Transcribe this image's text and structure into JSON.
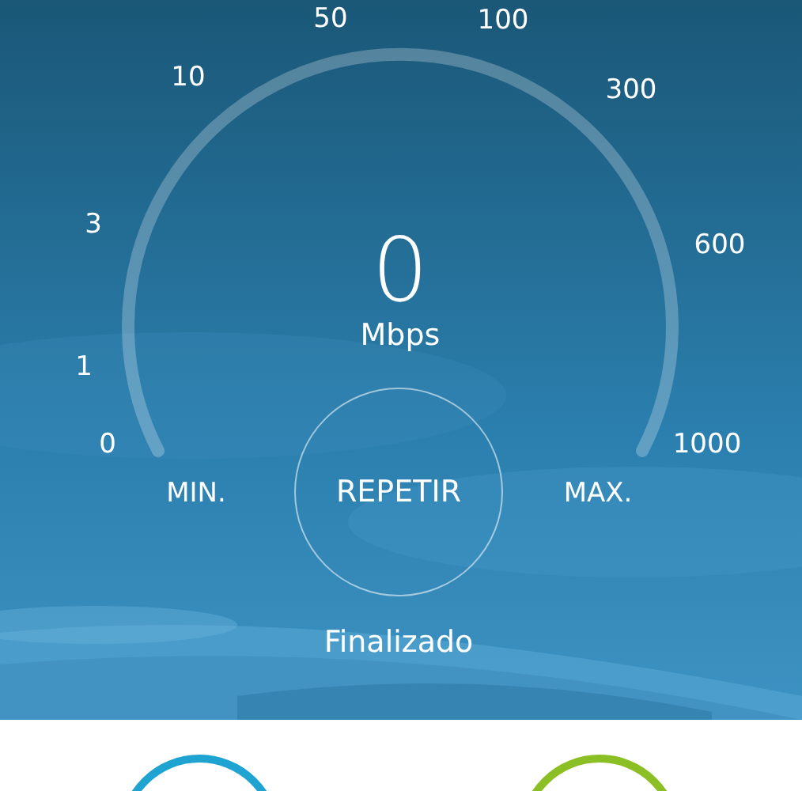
{
  "gauge": {
    "scale": [
      "0",
      "1",
      "3",
      "10",
      "50",
      "100",
      "300",
      "600",
      "1000"
    ],
    "value": "0",
    "unit": "Mbps",
    "min_label": "MIN.",
    "max_label": "MAX."
  },
  "repeat_button": {
    "label": "REPETIR"
  },
  "status": "Finalizado",
  "result_buttons": [
    {
      "color": "#1fa3d1"
    },
    {
      "color": "#8cbf26"
    }
  ]
}
